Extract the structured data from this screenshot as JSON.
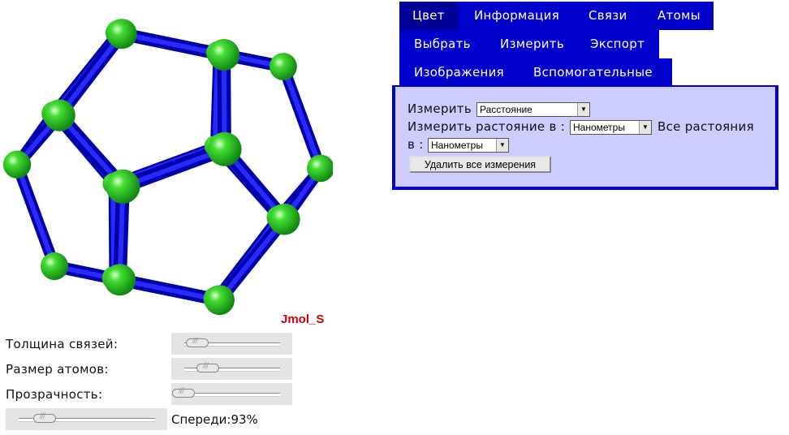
{
  "viewer": {
    "label": "Jmol_S"
  },
  "controls": {
    "bond_thickness": {
      "label": "Толщина связей:",
      "value": 0.1
    },
    "atom_size": {
      "label": "Размер атомов:",
      "value": 0.25
    },
    "transparency": {
      "label": "Прозрачность:",
      "value": 0.0
    },
    "front": {
      "label": "Спереди:",
      "value_text": "93%",
      "value": 0.2
    }
  },
  "menu": {
    "rows": [
      [
        {
          "label": "Цвет",
          "active": true
        },
        {
          "label": "Информация"
        },
        {
          "label": "Связи"
        },
        {
          "label": "Атомы"
        }
      ],
      [
        {
          "label": "Выбрать"
        },
        {
          "label": "Измерить"
        },
        {
          "label": "Экспорт"
        }
      ],
      [
        {
          "label": "Изображения"
        },
        {
          "label": "Вспомогательные"
        }
      ]
    ]
  },
  "panel": {
    "measure_label": "Измерить",
    "measure_select": "Расстояние",
    "distance_units_label": "Измерить растояние в :",
    "distance_units_select": "Нанометры",
    "all_distances_label_1": "Все растояния",
    "all_distances_label_2": "в :",
    "all_distances_select": "Нанометры",
    "delete_button": "Удалить все измерения"
  },
  "colors": {
    "menu_bg": "#0000cc",
    "menu_active": "#000099",
    "panel_bg": "#ccccff",
    "bond": "#1010d0",
    "atom": "#33cc33",
    "label": "#cc0000"
  }
}
